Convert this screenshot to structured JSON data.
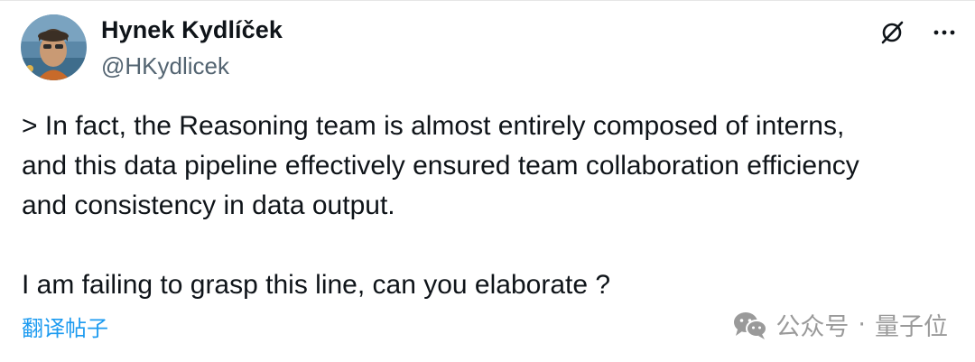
{
  "author": {
    "name": "Hynek Kydlíček",
    "handle": "@HKydlicek"
  },
  "header_icons": {
    "grok_icon": "grok-icon",
    "more_icon": "more-icon",
    "more_glyph": "···"
  },
  "tweet": {
    "lines": [
      "> In fact, the Reasoning team is almost entirely composed of interns,",
      "and this data pipeline effectively ensured team collaboration efficiency",
      "and consistency in data output.",
      "I am failing to grasp this line, can you elaborate ?"
    ]
  },
  "translate_label": "翻译帖子",
  "watermark": {
    "brand": "公众号",
    "separator": "·",
    "name": "量子位"
  },
  "colors": {
    "text": "#0f1419",
    "secondary": "#536471",
    "link": "#1d9bf0",
    "watermark": "#9a9a9a"
  }
}
